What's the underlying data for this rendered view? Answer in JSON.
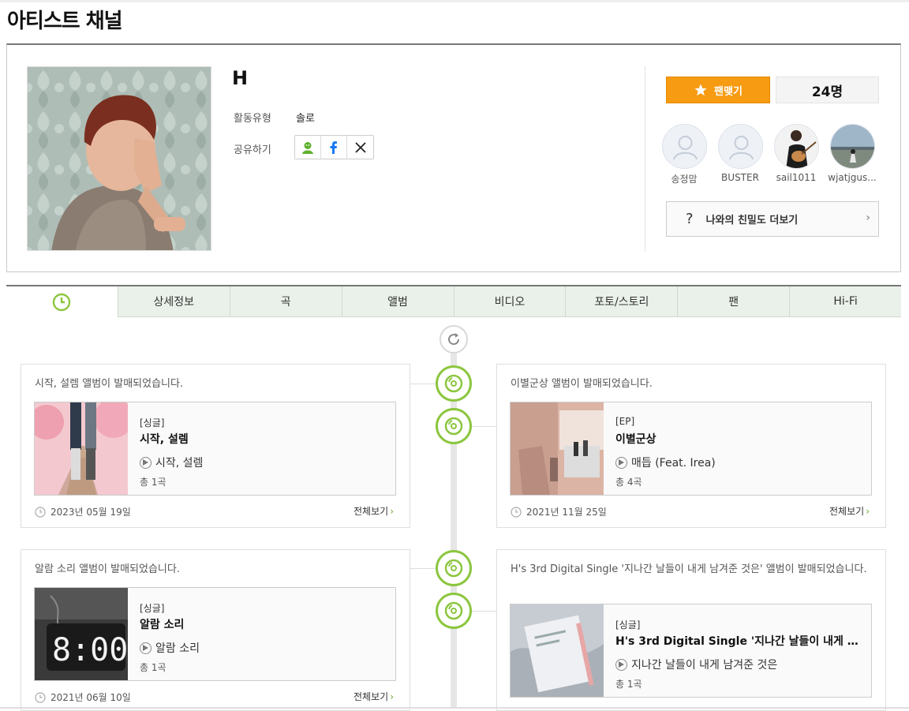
{
  "page": {
    "title": "아티스트 채널"
  },
  "artist": {
    "name": "H",
    "activity_label": "활동유형",
    "activity_value": "솔로",
    "share_label": "공유하기",
    "share_icons": [
      "melon-friend-icon",
      "facebook-icon",
      "x-icon"
    ]
  },
  "fan": {
    "button_label": "팬맺기",
    "count": "24명",
    "members": [
      {
        "name": "송정맘",
        "avatar": "default-avatar"
      },
      {
        "name": "BUSTER",
        "avatar": "default-avatar"
      },
      {
        "name": "sail1011",
        "avatar": "guitar-photo"
      },
      {
        "name": "wjatjgus...",
        "avatar": "beach-photo"
      }
    ],
    "intimacy_label": "나와의 친밀도 더보기",
    "intimacy_icon": "?"
  },
  "tabs": [
    {
      "label": "",
      "icon": "clock-icon"
    },
    {
      "label": "상세정보"
    },
    {
      "label": "곡"
    },
    {
      "label": "앨범"
    },
    {
      "label": "비디오"
    },
    {
      "label": "포토/스토리"
    },
    {
      "label": "팬"
    },
    {
      "label": "Hi-Fi"
    }
  ],
  "timeline": [
    {
      "headline": "시작, 설렘 앨범이 발매되었습니다.",
      "type": "[싱글]",
      "album": "시작, 설렘",
      "track": "시작, 설렘",
      "count": "총 1곡",
      "date": "2023년 05월 19일",
      "more": "전체보기"
    },
    {
      "headline": "이별군상 앨범이 발매되었습니다.",
      "type": "[EP]",
      "album": "이별군상",
      "track": "매듭 (Feat. Irea)",
      "count": "총 4곡",
      "date": "2021년 11월 25일",
      "more": "전체보기"
    },
    {
      "headline": "알람 소리 앨범이 발매되었습니다.",
      "type": "[싱글]",
      "album": "알람 소리",
      "track": "알람 소리",
      "count": "총 1곡",
      "date": "2021년 06월 10일",
      "more": "전체보기"
    },
    {
      "headline": "H's 3rd Digital Single '지나간 날들이 내게 남겨준 것은' 앨범이 발매되었습니다.",
      "type": "[싱글]",
      "album": "H's 3rd Digital Single '지나간 날들이 내게 남겨준 것은'",
      "track": "지나간 날들이 내게 남겨준 것은",
      "count": "총 1곡",
      "date": "",
      "more": ""
    }
  ],
  "colors": {
    "accent_green": "#8cc63f",
    "fan_orange": "#f79b12"
  }
}
